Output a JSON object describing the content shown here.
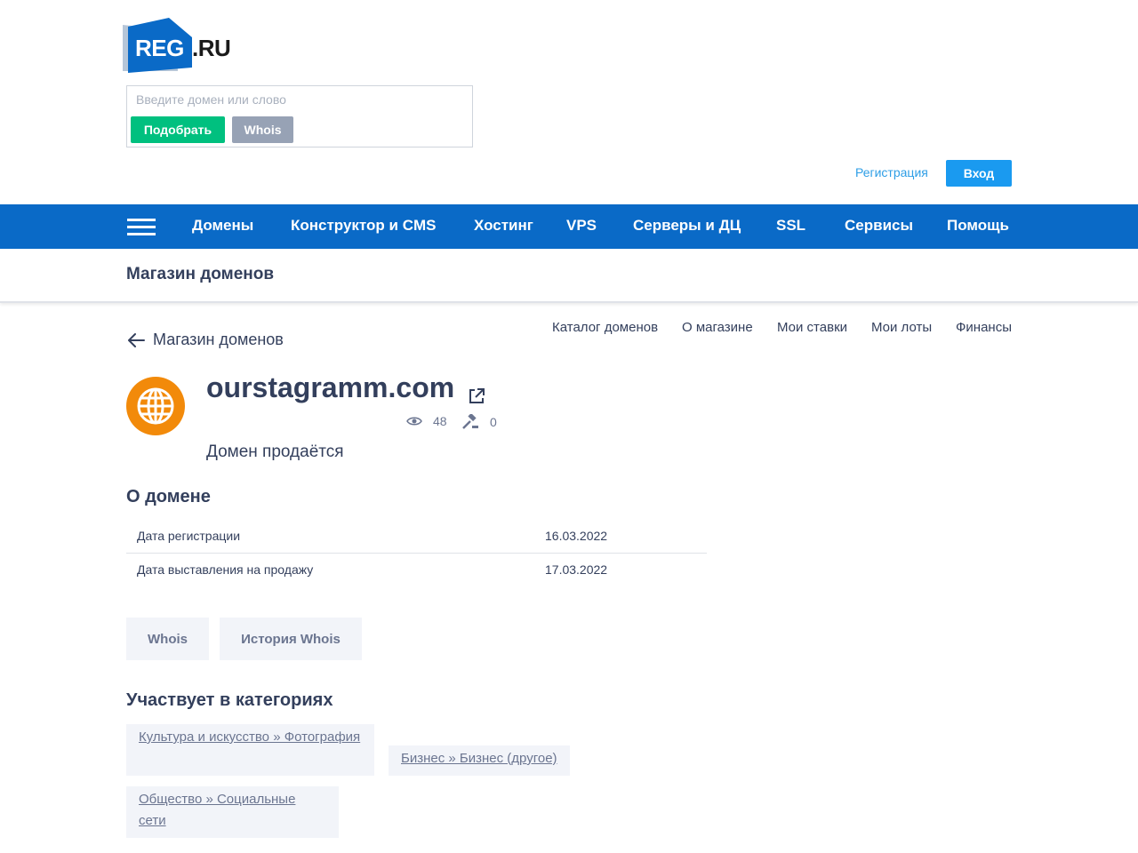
{
  "logo": {
    "text_main": "REG",
    "text_suffix": ".RU"
  },
  "search": {
    "placeholder": "Введите домен или слово",
    "pick_label": "Подобрать",
    "whois_label": "Whois"
  },
  "auth": {
    "register_label": "Регистрация",
    "login_label": "Вход"
  },
  "nav": {
    "items": [
      "Домены",
      "Конструктор и CMS",
      "Хостинг",
      "VPS",
      "Серверы и ДЦ",
      "SSL",
      "Сервисы",
      "Помощь"
    ]
  },
  "section": {
    "title": "Магазин доменов"
  },
  "back": {
    "label": "Магазин доменов"
  },
  "subnav": {
    "items": [
      "Каталог доменов",
      "О магазине",
      "Мои ставки",
      "Мои лоты",
      "Финансы"
    ]
  },
  "domain": {
    "name": "ourstagramm.com",
    "views": "48",
    "bids": "0",
    "status": "Домен продаётся"
  },
  "about": {
    "title": "О домене",
    "rows": [
      {
        "label": "Дата регистрации",
        "value": "16.03.2022"
      },
      {
        "label": "Дата выставления на продажу",
        "value": "17.03.2022"
      }
    ]
  },
  "actions": {
    "whois": "Whois",
    "whois_history": "История Whois"
  },
  "categories": {
    "title": "Участвует в категориях",
    "items": [
      "Культура и искусство » Фотография",
      "Бизнес » Бизнес (другое)",
      "Общество » Социальные сети"
    ]
  },
  "colors": {
    "brand_blue": "#0a6ac7",
    "green": "#00c07f",
    "orange": "#f28a0a",
    "link_blue": "#2e9ee6"
  }
}
